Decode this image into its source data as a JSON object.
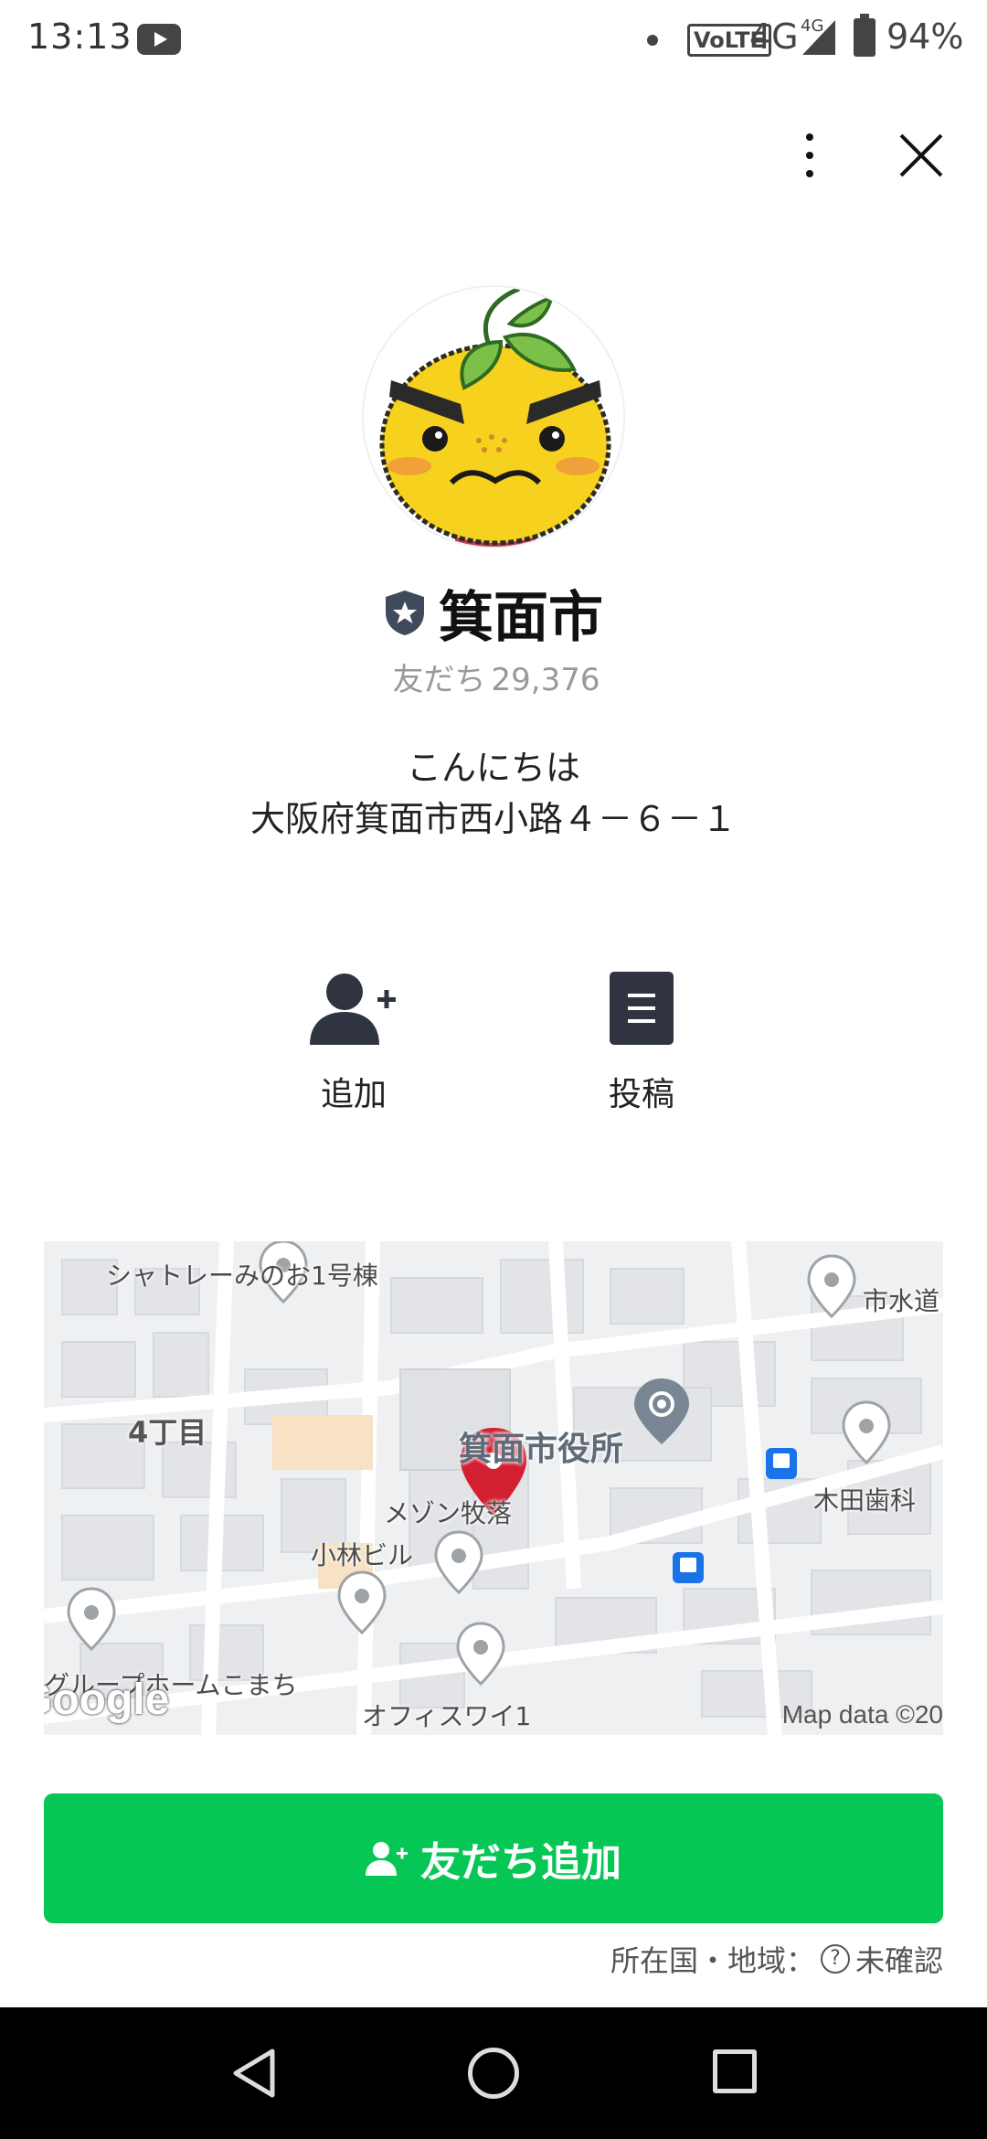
{
  "status_bar": {
    "time": "13:13",
    "volte": "VoLTE",
    "network": "4G",
    "network_small": "4G",
    "battery": "94%"
  },
  "profile": {
    "name": "箕面市",
    "friends_label": "友だち",
    "friends_count": "29,376",
    "status_line1": "こんにちは",
    "status_line2": "大阪府箕面市西小路４－６－１"
  },
  "actions": {
    "add_label": "追加",
    "post_label": "投稿"
  },
  "map": {
    "labels": {
      "chateau": "シャトレーみのお1号棟",
      "water": "市水道",
      "chome": "4丁目",
      "cityhall": "箕面市役所",
      "kida": "木田歯科",
      "maison": "メゾン牧落",
      "kobayashi": "小林ビル",
      "grouphome": "グループホームこまち",
      "office": "オフィスワイ1"
    },
    "google": "Google",
    "credit": "Map data ©20"
  },
  "add_friend_button": "友だち追加",
  "region": {
    "label": "所在国・地域：",
    "help": "?",
    "value": "未確認"
  },
  "colors": {
    "line_green": "#06c755",
    "pin_red": "#d32030",
    "map_bg": "#eef0f2"
  }
}
